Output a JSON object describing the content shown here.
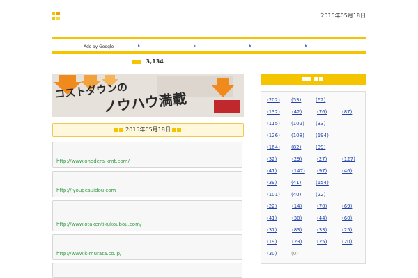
{
  "header": {
    "site_title": "",
    "description": "",
    "date_label": "2015年05月18日",
    "top_link": "",
    "logo_colors": [
      "#f5c400",
      "#f5a000",
      "#f5c400",
      "#f5d840"
    ]
  },
  "ads": {
    "small_label": "",
    "ads_by": "Ads by Google",
    "links": [
      "",
      "",
      "",
      ""
    ]
  },
  "stats": {
    "prefix": "",
    "count": "3,134",
    "suffix": ""
  },
  "banner": {
    "line1": "コストダウンの",
    "line2": "ノウハウ満載",
    "badge": ""
  },
  "date_box": {
    "prefix": "",
    "date": "2015年05月18日",
    "suffix": ""
  },
  "sites": [
    {
      "title": "",
      "description": "",
      "url": "http://www.onodera-kmt.com/"
    },
    {
      "title": "",
      "description": "",
      "url": "http://jyougesuidou.com"
    },
    {
      "title": "",
      "description": "",
      "url": "http://www.otakentikukoubou.com/"
    },
    {
      "title": "",
      "description": "",
      "url": "http://www.k-murata.co.jp/"
    },
    {
      "title": "",
      "description": "",
      "url": ""
    }
  ],
  "sidebar": {
    "heading": "",
    "categories": [
      {
        "name": "",
        "count": "(202)"
      },
      {
        "name": "",
        "count": "(53)"
      },
      {
        "name": "",
        "count": "(62)"
      },
      {
        "name": "",
        "count": "(132)"
      },
      {
        "name": "",
        "count": "(42)"
      },
      {
        "name": "",
        "count": "(76)"
      },
      {
        "name": "",
        "count": "(87)"
      },
      {
        "name": "",
        "count": "(115)"
      },
      {
        "name": "",
        "count": "(102)"
      },
      {
        "name": "",
        "count": "(33)"
      },
      {
        "name": "",
        "count": "(126)"
      },
      {
        "name": "",
        "count": "(108)"
      },
      {
        "name": "",
        "count": "(194)"
      },
      {
        "name": "",
        "count": "(164)"
      },
      {
        "name": "",
        "count": "(82)"
      },
      {
        "name": "",
        "count": "(39)"
      },
      {
        "name": "",
        "count": "(32)"
      },
      {
        "name": "",
        "count": "(29)"
      },
      {
        "name": "",
        "count": "(27)"
      },
      {
        "name": "",
        "count": "(127)"
      },
      {
        "name": "",
        "count": "(41)"
      },
      {
        "name": "",
        "count": "(147)"
      },
      {
        "name": "",
        "count": "(97)"
      },
      {
        "name": "",
        "count": "(46)"
      },
      {
        "name": "",
        "count": "(39)"
      },
      {
        "name": "",
        "count": "(41)"
      },
      {
        "name": "",
        "count": "(154)"
      },
      {
        "name": "",
        "count": "(101)"
      },
      {
        "name": "",
        "count": "(40)"
      },
      {
        "name": "",
        "count": "(22)"
      },
      {
        "name": "",
        "count": "(22)"
      },
      {
        "name": "",
        "count": "(14)"
      },
      {
        "name": "",
        "count": "(70)"
      },
      {
        "name": "",
        "count": "(69)"
      },
      {
        "name": "",
        "count": "(41)"
      },
      {
        "name": "",
        "count": "(30)"
      },
      {
        "name": "",
        "count": "(44)"
      },
      {
        "name": "",
        "count": "(60)"
      },
      {
        "name": "",
        "count": "(37)"
      },
      {
        "name": "",
        "count": "(83)"
      },
      {
        "name": "",
        "count": "(33)"
      },
      {
        "name": "",
        "count": "(25)"
      },
      {
        "name": "",
        "count": "(19)"
      },
      {
        "name": "",
        "count": "(23)"
      },
      {
        "name": "",
        "count": "(25)"
      },
      {
        "name": "",
        "count": "(20)"
      },
      {
        "name": "",
        "count": "(30)"
      },
      {
        "name": "",
        "count": "(0)"
      }
    ]
  }
}
